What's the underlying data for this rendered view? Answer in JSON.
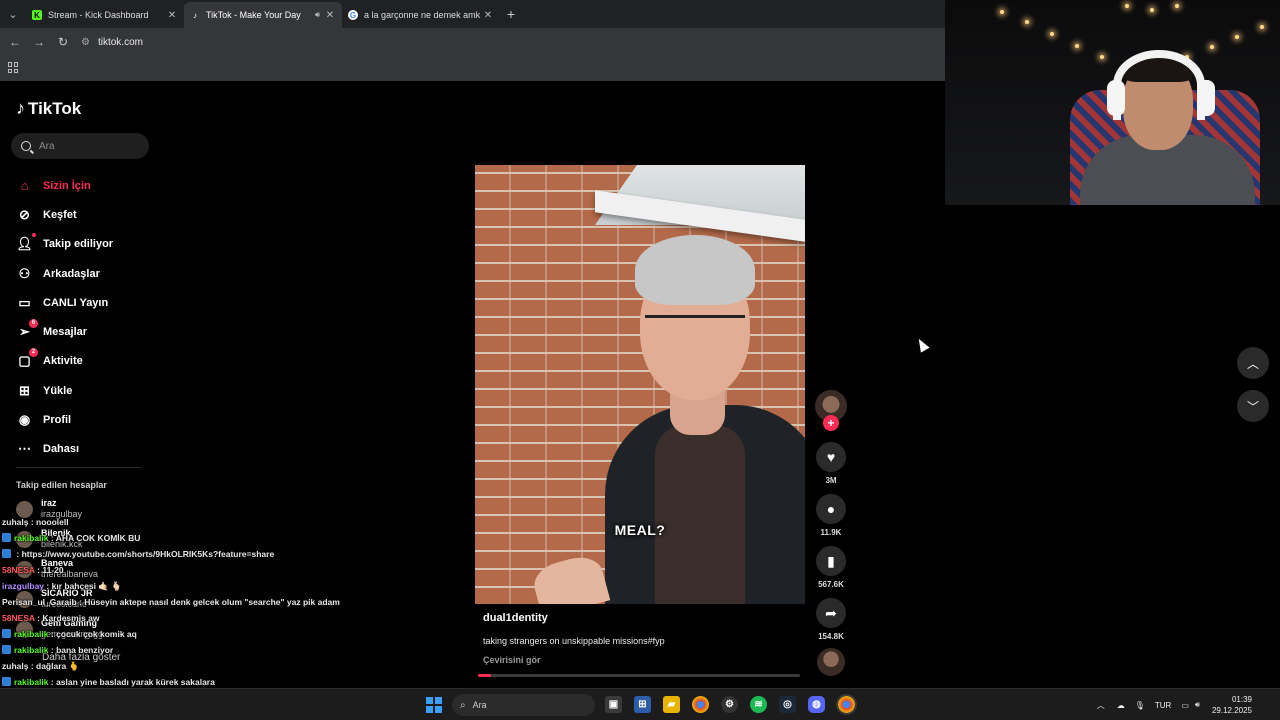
{
  "browser": {
    "tabs": [
      {
        "title": "Stream - Kick Dashboard",
        "favicon": "kick-icon",
        "active": false
      },
      {
        "title": "TikTok - Make Your Day",
        "favicon": "tiktok-icon",
        "active": true
      },
      {
        "title": "a la garçonne ne demek amk -",
        "favicon": "google-icon",
        "active": false
      }
    ],
    "url": "tiktok.com"
  },
  "tiktok": {
    "logo_text": "TikTok",
    "search_placeholder": "Ara",
    "menu": [
      {
        "label": "Sizin İçin",
        "icon": "home-icon",
        "active": true
      },
      {
        "label": "Keşfet",
        "icon": "compass-icon"
      },
      {
        "label": "Takip ediliyor",
        "icon": "following-icon"
      },
      {
        "label": "Arkadaşlar",
        "icon": "friends-icon"
      },
      {
        "label": "CANLI Yayın",
        "icon": "live-icon"
      },
      {
        "label": "Mesajlar",
        "icon": "messages-icon",
        "badge": "6"
      },
      {
        "label": "Aktivite",
        "icon": "activity-icon",
        "badge": "2"
      },
      {
        "label": "Yükle",
        "icon": "upload-icon"
      },
      {
        "label": "Profil",
        "icon": "profile-icon"
      },
      {
        "label": "Dahası",
        "icon": "more-icon"
      }
    ],
    "following_header": "Takip edilen hesaplar",
    "following": [
      {
        "name": "iraz",
        "handle": "irazgulbay"
      },
      {
        "name": "Bilenik",
        "handle": "bilenik.kck"
      },
      {
        "name": "Baneva",
        "handle": "therealbaneva"
      },
      {
        "name": "SICARIO JR",
        "handle": "turcosicario"
      },
      {
        "name": "Gem Gaming",
        "handle": "gem.gaming.gg"
      }
    ],
    "more_link": "Daha fazla göster",
    "video": {
      "overlay_text": "MEAL?",
      "author": "dual1dentity",
      "description": "taking strangers on unskippable missions#fyp",
      "translate": "Çevirisini gör",
      "progress": 0.04
    },
    "actions": {
      "likes": "3M",
      "comments": "11.9K",
      "saves": "567.6K",
      "shares": "154.8K"
    }
  },
  "chat": [
    {
      "user": "zuhalş",
      "text": "nooolell",
      "color": "white",
      "kick": false
    },
    {
      "user": "rakibalik",
      "text": "AHA COK KOMİK BU",
      "color": "green",
      "kick": true
    },
    {
      "user": "",
      "text": "https://www.youtube.com/shorts/9HkOLRIK5Ks?feature=share",
      "color": "red",
      "kick": true
    },
    {
      "user": "58NESA",
      "text": "11-20",
      "color": "red",
      "kick": false
    },
    {
      "user": "irazgulbay",
      "text": "kır bahçesi 🤙🏻 🫰🏻",
      "color": "purple",
      "kick": false
    },
    {
      "user": "Perisan_ul_Garaib",
      "text": "Hüseyin aktepe nasıl denk gelcek olum \"searche\" yaz pik adam",
      "color": "white",
      "kick": false
    },
    {
      "user": "58NESA",
      "text": "Kardesmis aw",
      "color": "red",
      "kick": false
    },
    {
      "user": "rakibalik",
      "text": "çocuk çok komik aq",
      "color": "green",
      "kick": true
    },
    {
      "user": "rakibalik",
      "text": "bana benziyor",
      "color": "green",
      "kick": true
    },
    {
      "user": "zuhalş",
      "text": "dağlara 🫰",
      "color": "white",
      "kick": false
    },
    {
      "user": "rakibalik",
      "text": "aslan yine basladı yarak kürek sakalara",
      "color": "green",
      "kick": true
    }
  ],
  "taskbar": {
    "search_placeholder": "Ara",
    "language": "TUR",
    "time": "01:39",
    "date": "29.12.2025"
  }
}
